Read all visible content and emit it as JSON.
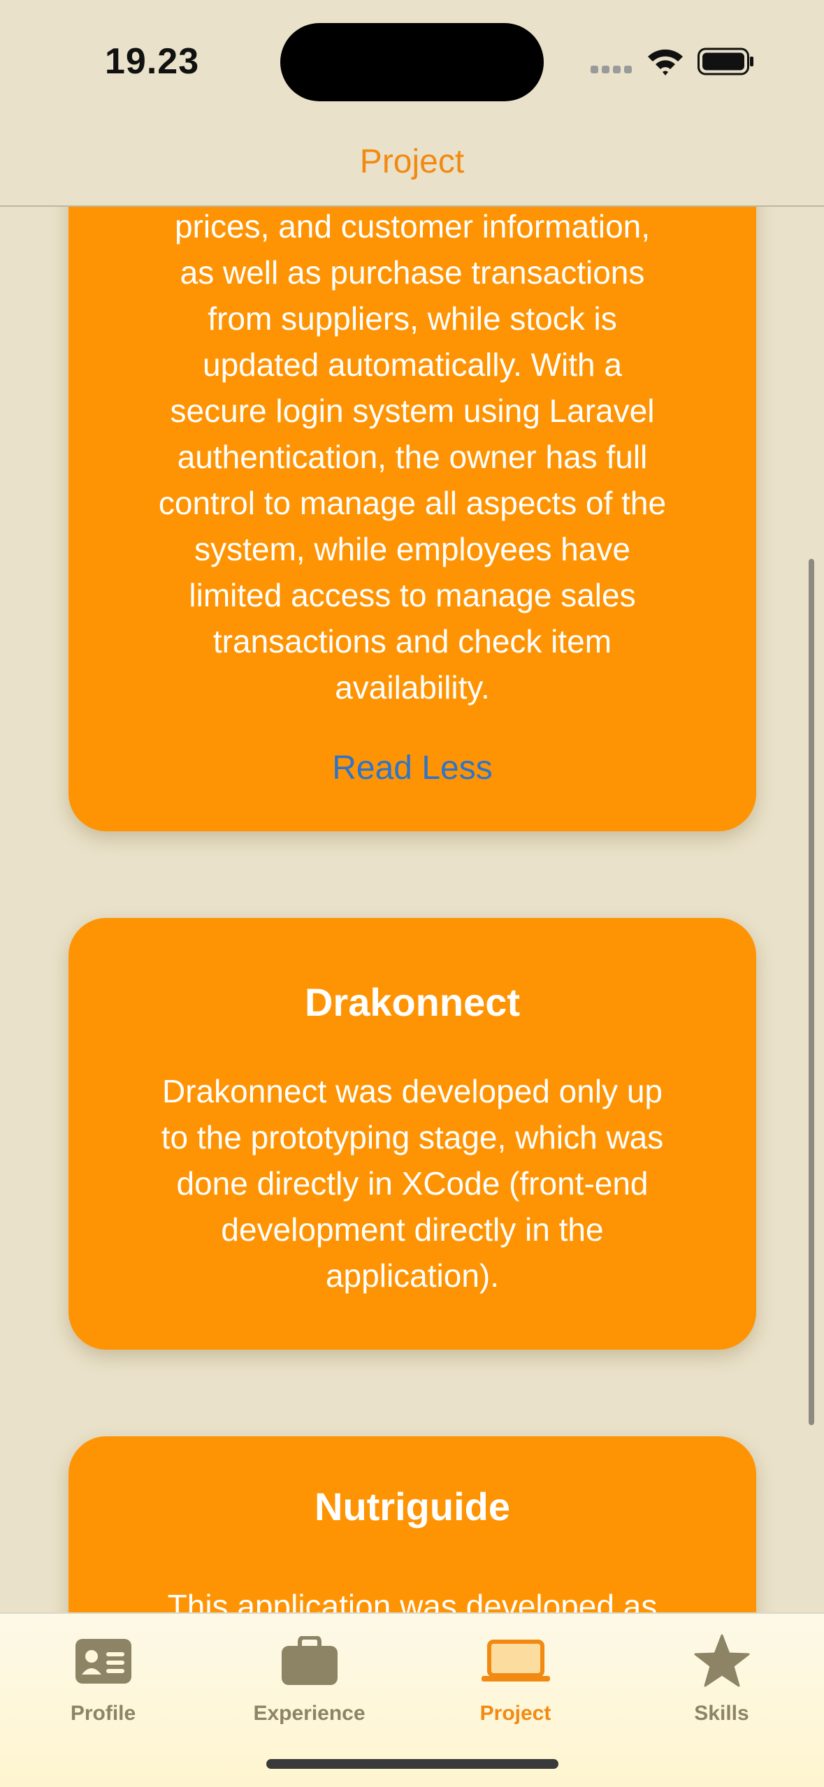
{
  "status_bar": {
    "time": "19.23"
  },
  "nav": {
    "title": "Project"
  },
  "cards": [
    {
      "title": "",
      "description_lines": [
        "prices, and customer information,",
        "as well as purchase transactions",
        "from suppliers, while stock is",
        "updated automatically. With a",
        "secure login system using Laravel",
        "authentication, the owner has full",
        "control to manage all aspects of the",
        "system, while employees have",
        "limited access to manage sales",
        "transactions and check item",
        "availability."
      ],
      "toggle_label": "Read Less"
    },
    {
      "title": "Drakonnect",
      "description_lines": [
        "Drakonnect was developed only up",
        "to the prototyping stage, which was",
        "done directly in XCode (front-end",
        "development directly in the",
        "application)."
      ]
    },
    {
      "title": "Nutriguide",
      "description_lines": [
        "This application was developed as"
      ]
    }
  ],
  "tab_bar": {
    "tabs": [
      {
        "label": "Profile",
        "icon": "person-card-icon",
        "active": false
      },
      {
        "label": "Experience",
        "icon": "briefcase-icon",
        "active": false
      },
      {
        "label": "Project",
        "icon": "laptop-icon",
        "active": true
      },
      {
        "label": "Skills",
        "icon": "star-icon",
        "active": false
      }
    ]
  },
  "colors": {
    "accent": "#F28A12",
    "card": "#FE9404",
    "background": "#E9E1C9",
    "link": "#2F74C8",
    "tab_inactive": "#8D8466"
  }
}
